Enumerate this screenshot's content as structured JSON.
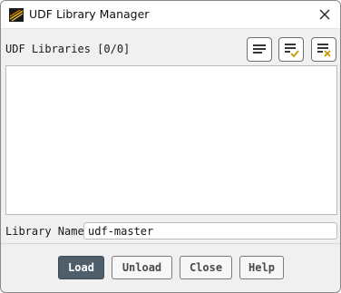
{
  "window": {
    "title": "UDF Library Manager",
    "app_icon": "fluent-logo-icon",
    "close_icon": "close-icon"
  },
  "libraries": {
    "label": "UDF Libraries [0/0]",
    "items": [],
    "toolbar": [
      {
        "icon": "list-icon",
        "name": "list-button"
      },
      {
        "icon": "select-all-icon",
        "name": "select-all-button",
        "accent": "#c79a00"
      },
      {
        "icon": "deselect-all-icon",
        "name": "deselect-all-button",
        "accent": "#c79a00"
      }
    ]
  },
  "library_name": {
    "label": "Library Name",
    "value": "udf-master"
  },
  "buttons": {
    "load": "Load",
    "unload": "Unload",
    "close": "Close",
    "help": "Help"
  },
  "colors": {
    "primary_button": "#4f5e6b",
    "accent": "#c79a00"
  }
}
